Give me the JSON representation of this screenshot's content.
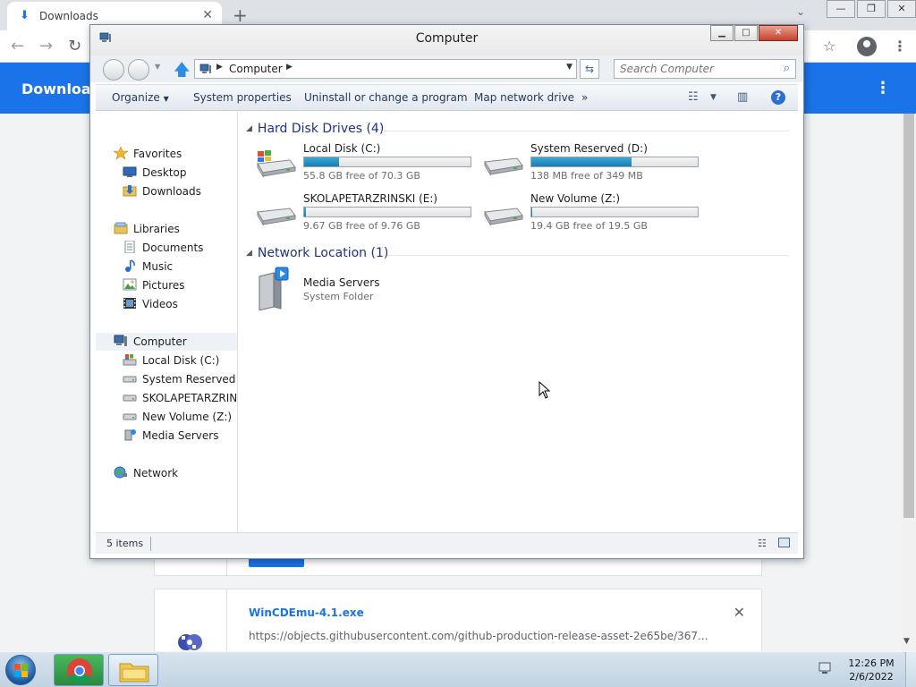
{
  "browser": {
    "tab_title": "Downloads",
    "page_title": "Downloads",
    "downloads": [
      {
        "name": "WinCDEmu-4.1.exe",
        "url": "https://objects.githubusercontent.com/github-production-release-asset-2e65be/367..."
      }
    ]
  },
  "window": {
    "title": "Computer"
  },
  "address": {
    "location": "Computer"
  },
  "search": {
    "placeholder": "Search Computer"
  },
  "commands": {
    "organize": "Organize",
    "system_properties": "System properties",
    "uninstall": "Uninstall or change a program",
    "map_network": "Map network drive",
    "more": "»"
  },
  "nav": {
    "favorites": "Favorites",
    "desktop": "Desktop",
    "downloads": "Downloads",
    "libraries": "Libraries",
    "documents": "Documents",
    "music": "Music",
    "pictures": "Pictures",
    "videos": "Videos",
    "computer": "Computer",
    "local_disk": "Local Disk (C:)",
    "system_reserved": "System Reserved (D:",
    "skola": "SKOLAPETARZRINSKI",
    "new_volume": "New Volume (Z:)",
    "media_servers": "Media Servers",
    "network": "Network"
  },
  "groups": {
    "hard_disk": "Hard Disk Drives (4)",
    "network_location": "Network Location (1)"
  },
  "drives": [
    {
      "name": "Local Disk (C:)",
      "free": "55.8 GB free of 70.3 GB",
      "used_fraction": 0.21
    },
    {
      "name": "System Reserved (D:)",
      "free": "138 MB free of 349 MB",
      "used_fraction": 0.6
    },
    {
      "name": "SKOLAPETARZRINSKI (E:)",
      "free": "9.67 GB free of 9.76 GB",
      "used_fraction": 0.01
    },
    {
      "name": "New Volume (Z:)",
      "free": "19.4 GB free of 19.5 GB",
      "used_fraction": 0.005
    }
  ],
  "network_location": {
    "name": "Media Servers",
    "type": "System Folder"
  },
  "status": {
    "items": "5 items"
  },
  "clock": {
    "time": "12:26 PM",
    "date": "2/6/2022"
  },
  "colors": {
    "browser_accent": "#1a73e8",
    "drive_fill": "#1c7cb0",
    "group_header": "#1e3287"
  }
}
